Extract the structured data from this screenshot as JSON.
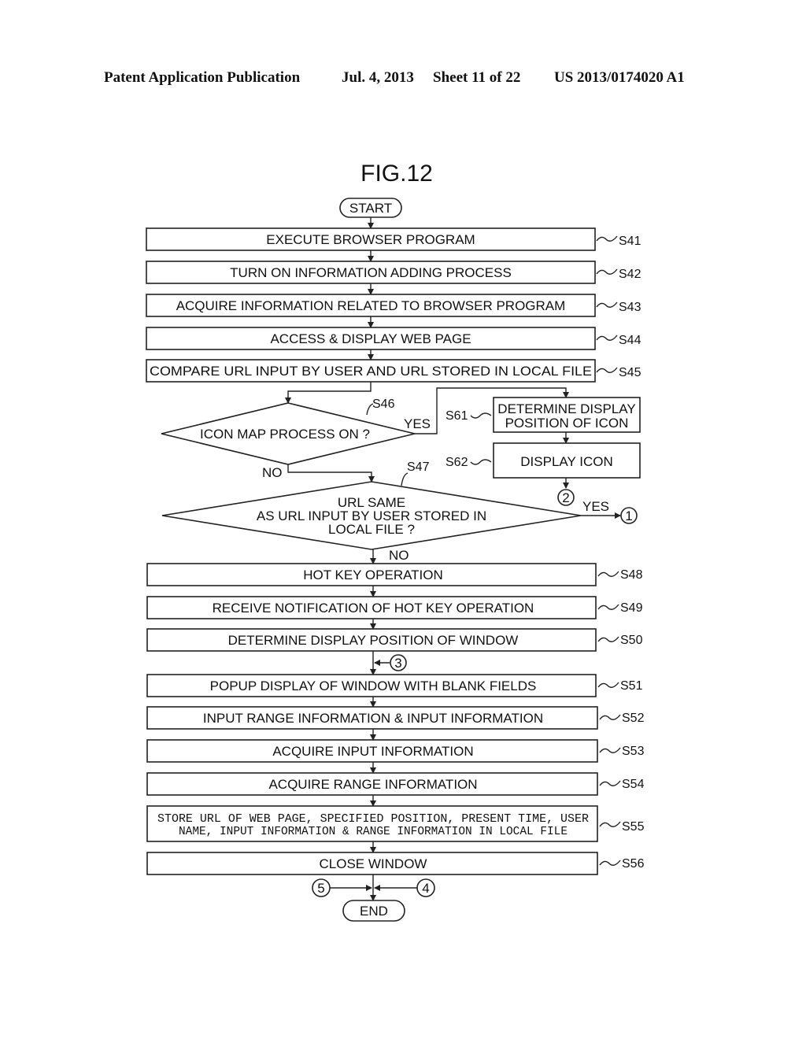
{
  "header": {
    "publication": "Patent Application Publication",
    "date": "Jul. 4, 2013",
    "sheet": "Sheet 11 of 22",
    "number": "US 2013/0174020 A1"
  },
  "figure": {
    "title": "FIG.12",
    "start": "START",
    "end": "END",
    "steps": {
      "s41": {
        "id": "S41",
        "text": "EXECUTE BROWSER PROGRAM"
      },
      "s42": {
        "id": "S42",
        "text": "TURN ON INFORMATION ADDING PROCESS"
      },
      "s43": {
        "id": "S43",
        "text": "ACQUIRE INFORMATION RELATED TO BROWSER PROGRAM"
      },
      "s44": {
        "id": "S44",
        "text": "ACCESS & DISPLAY WEB PAGE"
      },
      "s45": {
        "id": "S45",
        "text": "COMPARE URL INPUT BY USER AND URL STORED IN LOCAL FILE"
      },
      "s46": {
        "id": "S46",
        "text": "ICON MAP PROCESS ON ?"
      },
      "s47": {
        "id": "S47",
        "line1": "URL SAME",
        "line2": "AS URL INPUT BY USER STORED IN",
        "line3": "LOCAL FILE ?"
      },
      "s48": {
        "id": "S48",
        "text": "HOT KEY OPERATION"
      },
      "s49": {
        "id": "S49",
        "text": "RECEIVE NOTIFICATION OF HOT KEY OPERATION"
      },
      "s50": {
        "id": "S50",
        "text": "DETERMINE DISPLAY POSITION OF WINDOW"
      },
      "s51": {
        "id": "S51",
        "text": "POPUP DISPLAY OF WINDOW WITH BLANK FIELDS"
      },
      "s52": {
        "id": "S52",
        "text": "INPUT RANGE INFORMATION & INPUT INFORMATION"
      },
      "s53": {
        "id": "S53",
        "text": "ACQUIRE INPUT INFORMATION"
      },
      "s54": {
        "id": "S54",
        "text": "ACQUIRE RANGE INFORMATION"
      },
      "s55": {
        "id": "S55",
        "line1": "STORE URL OF WEB PAGE, SPECIFIED POSITION, PRESENT TIME, USER",
        "line2": "NAME, INPUT INFORMATION & RANGE INFORMATION IN LOCAL FILE"
      },
      "s56": {
        "id": "S56",
        "text": "CLOSE WINDOW"
      },
      "s61": {
        "id": "S61",
        "line1": "DETERMINE DISPLAY",
        "line2": "POSITION OF ICON"
      },
      "s62": {
        "id": "S62",
        "text": "DISPLAY ICON"
      }
    },
    "branches": {
      "s46_yes": "YES",
      "s46_no": "NO",
      "s47_yes": "YES",
      "s47_no": "NO"
    },
    "connectors": {
      "c1": "1",
      "c2": "2",
      "c3": "3",
      "c4": "4",
      "c5": "5"
    }
  }
}
